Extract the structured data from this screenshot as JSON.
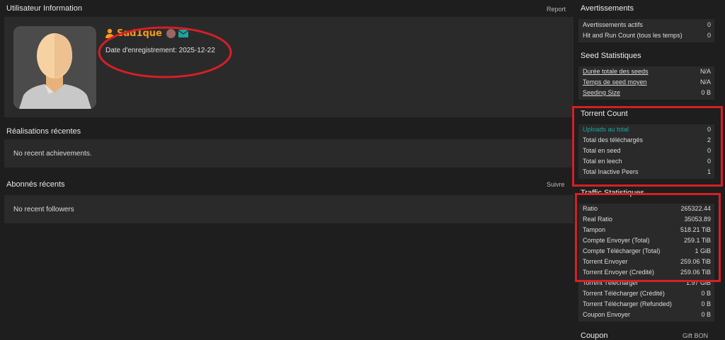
{
  "user_panel": {
    "title": "Utilisateur Information",
    "report_label": "Report",
    "username": "Sad1que",
    "registration": "Date d'enregistrement: 2025-12-22"
  },
  "achievements": {
    "title": "Réalisations récentes",
    "empty": "No recent achievements."
  },
  "followers": {
    "title": "Abonnés récents",
    "follow_label": "Suivre",
    "empty": "No recent followers"
  },
  "warnings": {
    "title": "Avertissements",
    "rows": [
      {
        "label": "Avertissements actifs",
        "value": "0"
      },
      {
        "label": "Hit and Run Count (tous les temps)",
        "value": "0"
      }
    ]
  },
  "seed_stats": {
    "title": "Seed Statistiques",
    "rows": [
      {
        "label": "Durée totale des seeds",
        "value": "N/A"
      },
      {
        "label": "Temps de seed moyen",
        "value": "N/A"
      },
      {
        "label": "Seeding Size",
        "value": "0 B"
      }
    ]
  },
  "torrent_count": {
    "title": "Torrent Count",
    "rows": [
      {
        "label": "Uploads au total",
        "value": "0"
      },
      {
        "label": "Total des téléchargés",
        "value": "2"
      },
      {
        "label": "Total en seed",
        "value": "0"
      },
      {
        "label": "Total en leech",
        "value": "0"
      },
      {
        "label": "Total Inactive Peers",
        "value": "1"
      }
    ]
  },
  "traffic": {
    "title": "Traffic Statistiques",
    "rows": [
      {
        "label": "Ratio",
        "value": "265322.44"
      },
      {
        "label": "Real Ratio",
        "value": "35053.89"
      },
      {
        "label": "Tampon",
        "value": "518.21 TiB"
      },
      {
        "label": "Compte Envoyer (Total)",
        "value": "259.1 TiB"
      },
      {
        "label": "Compte Télécharger (Total)",
        "value": "1 GiB"
      },
      {
        "label": "Torrent Envoyer",
        "value": "259.06 TiB"
      },
      {
        "label": "Torrent Envoyer (Credité)",
        "value": "259.06 TiB"
      },
      {
        "label": "Torrent Télécharger",
        "value": "1.97 GiB"
      },
      {
        "label": "Torrent Télécharger (Crédité)",
        "value": "0 B"
      },
      {
        "label": "Torrent Télécharger (Refunded)",
        "value": "0 B"
      },
      {
        "label": "Coupon Envoyer",
        "value": "0 B"
      }
    ]
  },
  "coupon": {
    "title": "Coupon",
    "gift_label": "Gift BON"
  },
  "colors": {
    "annotation_red": "#d51f26",
    "username_orange": "#f39a1e",
    "teal": "#1aa6a0"
  },
  "icons": [
    "user-icon",
    "status-dot-icon",
    "envelope-icon",
    "avatar-placeholder"
  ]
}
